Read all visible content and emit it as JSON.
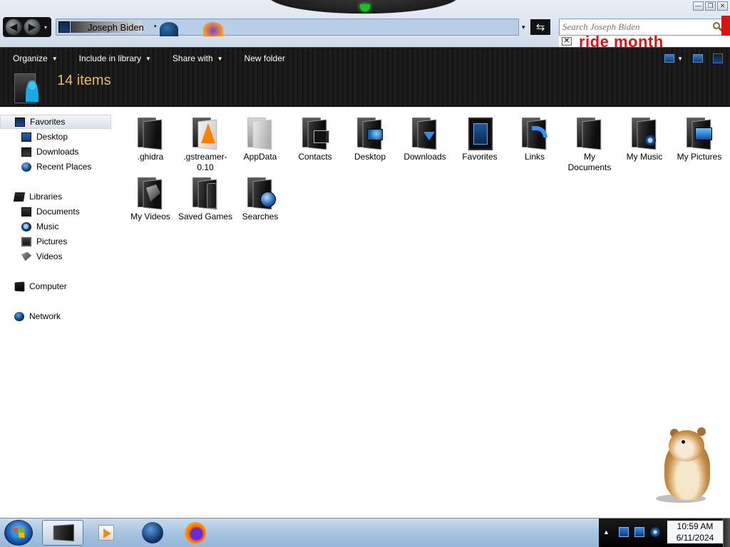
{
  "window": {
    "controls": {
      "minimize": "—",
      "maximize": "❐",
      "close": "✕"
    }
  },
  "address": {
    "path_text": "Joseph Biden",
    "separator": "•",
    "dropdown_glyph": "▾",
    "refresh_glyph": "⇆"
  },
  "nav": {
    "back_glyph": "◀",
    "forward_glyph": "▶",
    "recent_glyph": "▾"
  },
  "search": {
    "placeholder": "Search Joseph Biden",
    "value": ""
  },
  "ad": {
    "text": "ride month",
    "close_glyph": "✕"
  },
  "toolbar": {
    "commands": [
      {
        "label": "Organize",
        "has_dropdown": true
      },
      {
        "label": "Include in library",
        "has_dropdown": true
      },
      {
        "label": "Share with",
        "has_dropdown": true
      },
      {
        "label": "New folder",
        "has_dropdown": false
      }
    ],
    "caret_glyph": "▼"
  },
  "details": {
    "item_count": "14 items"
  },
  "sidebar": {
    "favorites": {
      "label": "Favorites",
      "items": [
        "Desktop",
        "Downloads",
        "Recent Places"
      ]
    },
    "libraries": {
      "label": "Libraries",
      "items": [
        "Documents",
        "Music",
        "Pictures",
        "Videos"
      ]
    },
    "computer": {
      "label": "Computer"
    },
    "network": {
      "label": "Network"
    }
  },
  "files": [
    {
      "name": ".ghidra",
      "icon": "dark-folder-icon"
    },
    {
      "name": ".gstreamer-0.10",
      "icon": "vlc-folder-icon"
    },
    {
      "name": "AppData",
      "icon": "light-folder-icon"
    },
    {
      "name": "Contacts",
      "icon": "contacts-folder-icon"
    },
    {
      "name": "Desktop",
      "icon": "desktop-folder-icon"
    },
    {
      "name": "Downloads",
      "icon": "downloads-folder-icon"
    },
    {
      "name": "Favorites",
      "icon": "favorites-folder-icon"
    },
    {
      "name": "Links",
      "icon": "links-folder-icon"
    },
    {
      "name": "My Documents",
      "icon": "documents-folder-icon"
    },
    {
      "name": "My Music",
      "icon": "music-folder-icon"
    },
    {
      "name": "My Pictures",
      "icon": "pictures-folder-icon"
    },
    {
      "name": "My Videos",
      "icon": "videos-folder-icon"
    },
    {
      "name": "Saved Games",
      "icon": "saved-games-folder-icon"
    },
    {
      "name": "Searches",
      "icon": "searches-folder-icon"
    }
  ],
  "taskbar": {
    "pinned": [
      "explorer-icon",
      "media-player-icon",
      "internet-explorer-icon",
      "firefox-icon"
    ],
    "tray_arrow": "▲",
    "clock": {
      "time": "10:59 AM",
      "date": "6/11/2024"
    }
  }
}
